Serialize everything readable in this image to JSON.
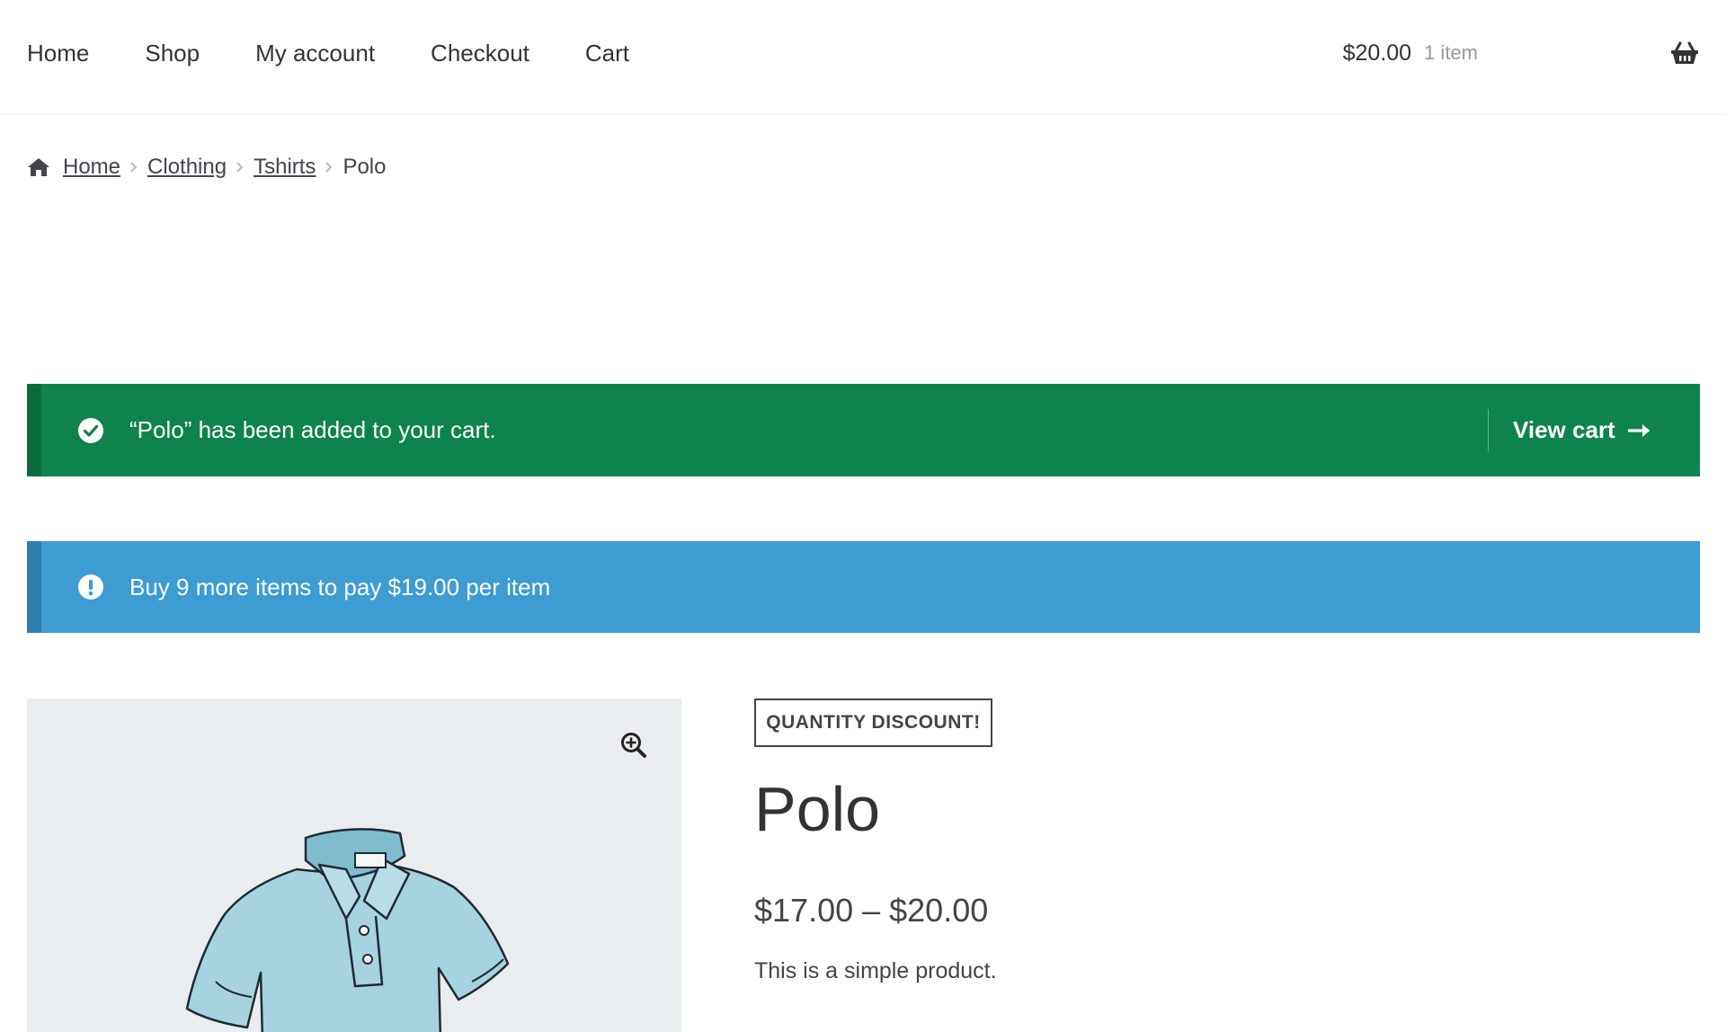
{
  "nav": {
    "items": [
      {
        "label": "Home"
      },
      {
        "label": "Shop"
      },
      {
        "label": "My account"
      },
      {
        "label": "Checkout"
      },
      {
        "label": "Cart"
      }
    ]
  },
  "mini_cart": {
    "amount": "$20.00",
    "count": "1 item",
    "icon": "basket-icon"
  },
  "breadcrumb": {
    "links": [
      {
        "label": "Home"
      },
      {
        "label": "Clothing"
      },
      {
        "label": "Tshirts"
      }
    ],
    "current": "Polo",
    "home_icon": "home-icon"
  },
  "notices": {
    "success": {
      "message": "“Polo” has been added to your cart.",
      "action": "View cart",
      "icon": "check-circle-icon",
      "color": "#0f834d"
    },
    "info": {
      "message": "Buy 9 more items to pay $19.00 per item",
      "icon": "exclamation-circle-icon",
      "color": "#3d9cd2"
    }
  },
  "product": {
    "badge": "QUANTITY DISCOUNT!",
    "title": "Polo",
    "price": "$17.00 – $20.00",
    "description": "This is a simple product.",
    "zoom_icon": "zoom-in-icon"
  }
}
